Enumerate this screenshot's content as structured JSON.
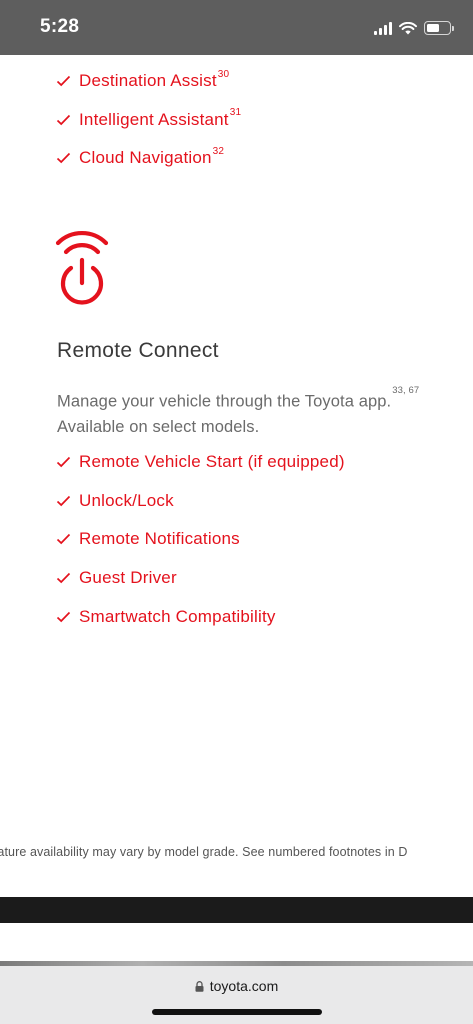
{
  "status_bar": {
    "time": "5:28"
  },
  "top_features": [
    {
      "label": "Destination Assist",
      "footnote": "30"
    },
    {
      "label": "Intelligent Assistant",
      "footnote": "31"
    },
    {
      "label": "Cloud Navigation",
      "footnote": "32"
    }
  ],
  "remote_connect": {
    "icon": "remote-power-icon",
    "title": "Remote Connect",
    "description": "Manage your vehicle through the Toyota app.",
    "description_footnote": "33, 67",
    "description_line2": "Available on select models.",
    "features": [
      {
        "label": "Remote Vehicle Start (if equipped)"
      },
      {
        "label": "Unlock/Lock"
      },
      {
        "label": "Remote Notifications"
      },
      {
        "label": "Guest Driver"
      },
      {
        "label": "Smartwatch Compatibility"
      }
    ]
  },
  "footnote_text": "eir feature availability may vary by model grade. See numbered footnotes in D",
  "browser": {
    "url": "toyota.com"
  },
  "colors": {
    "accent": "#e4121d",
    "status_bar_bg": "#5e5e5e"
  }
}
